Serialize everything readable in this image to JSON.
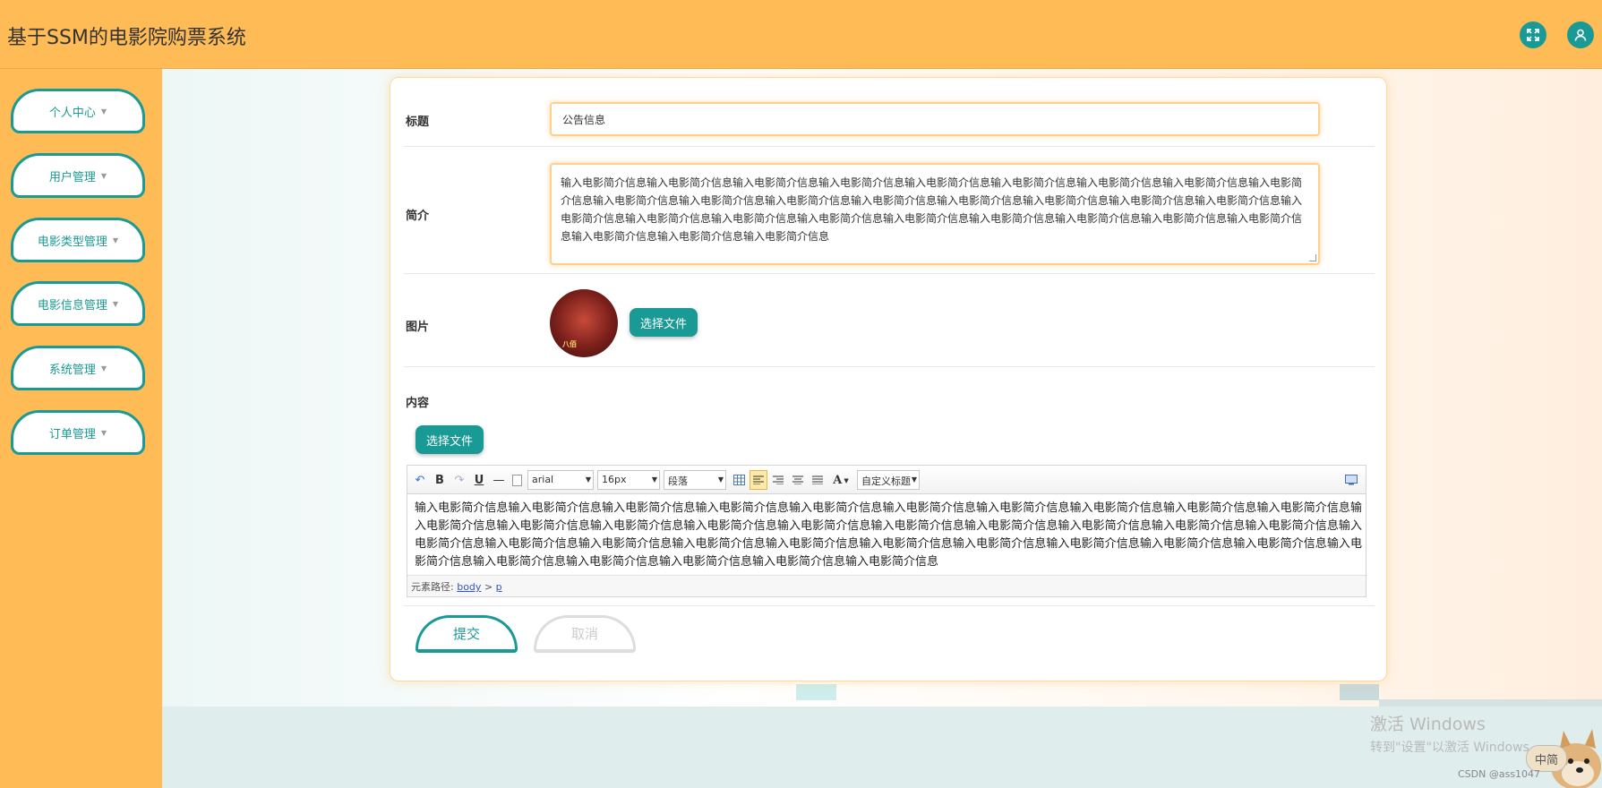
{
  "app": {
    "title": "基于SSM的电影院购票系统"
  },
  "header": {
    "icons": [
      "fullscreen-icon",
      "user-icon"
    ]
  },
  "sidebar": {
    "items": [
      {
        "label": "个人中心"
      },
      {
        "label": "用户管理"
      },
      {
        "label": "电影类型管理"
      },
      {
        "label": "电影信息管理"
      },
      {
        "label": "系统管理"
      },
      {
        "label": "订单管理"
      }
    ]
  },
  "form": {
    "title_label": "标题",
    "title_value": "公告信息",
    "intro_label": "简介",
    "intro_value": "输入电影简介信息输入电影简介信息输入电影简介信息输入电影简介信息输入电影简介信息输入电影简介信息输入电影简介信息输入电影简介信息输入电影简介信息输入电影简介信息输入电影简介信息输入电影简介信息输入电影简介信息输入电影简介信息输入电影简介信息输入电影简介信息输入电影简介信息输入电影简介信息输入电影简介信息输入电影简介信息输入电影简介信息输入电影简介信息输入电影简介信息输入电影简介信息输入电影简介信息输入电影简介信息输入电影简介信息输入电影简介信息输入电影简介信息",
    "image_label": "图片",
    "choose_file": "选择文件",
    "content_label": "内容",
    "content_choose_file": "选择文件",
    "poster_text": "八佰",
    "submit": "提交",
    "cancel": "取消"
  },
  "editor": {
    "font_family": "arial",
    "font_size": "16px",
    "paragraph": "段落",
    "custom_title": "自定义标题",
    "bold": "B",
    "underline": "U",
    "font_color": "A",
    "content": "输入电影简介信息输入电影简介信息输入电影简介信息输入电影简介信息输入电影简介信息输入电影简介信息输入电影简介信息输入电影简介信息输入电影简介信息输入电影简介信息输入电影简介信息输入电影简介信息输入电影简介信息输入电影简介信息输入电影简介信息输入电影简介信息输入电影简介信息输入电影简介信息输入电影简介信息输入电影简介信息输入电影简介信息输入电影简介信息输入电影简介信息输入电影简介信息输入电影简介信息输入电影简介信息输入电影简介信息输入电影简介信息输入电影简介信息输入电影简介信息输入电影简介信息输入电影简介信息输入电影简介信息输入电影简介信息输入电影简介信息输入电影简介信息",
    "path_prefix": "元素路径:",
    "path_body": "body",
    "path_sep": ">",
    "path_p": "p"
  },
  "overlay": {
    "activate_line1": "激活 Windows",
    "activate_line2": "转到\"设置\"以激活 Windows。",
    "csdn": "CSDN @ass1047",
    "ime": "中简"
  },
  "colors": {
    "accent": "#1a9a94",
    "background": "#ffbb55",
    "input_border": "#ffd08a"
  }
}
